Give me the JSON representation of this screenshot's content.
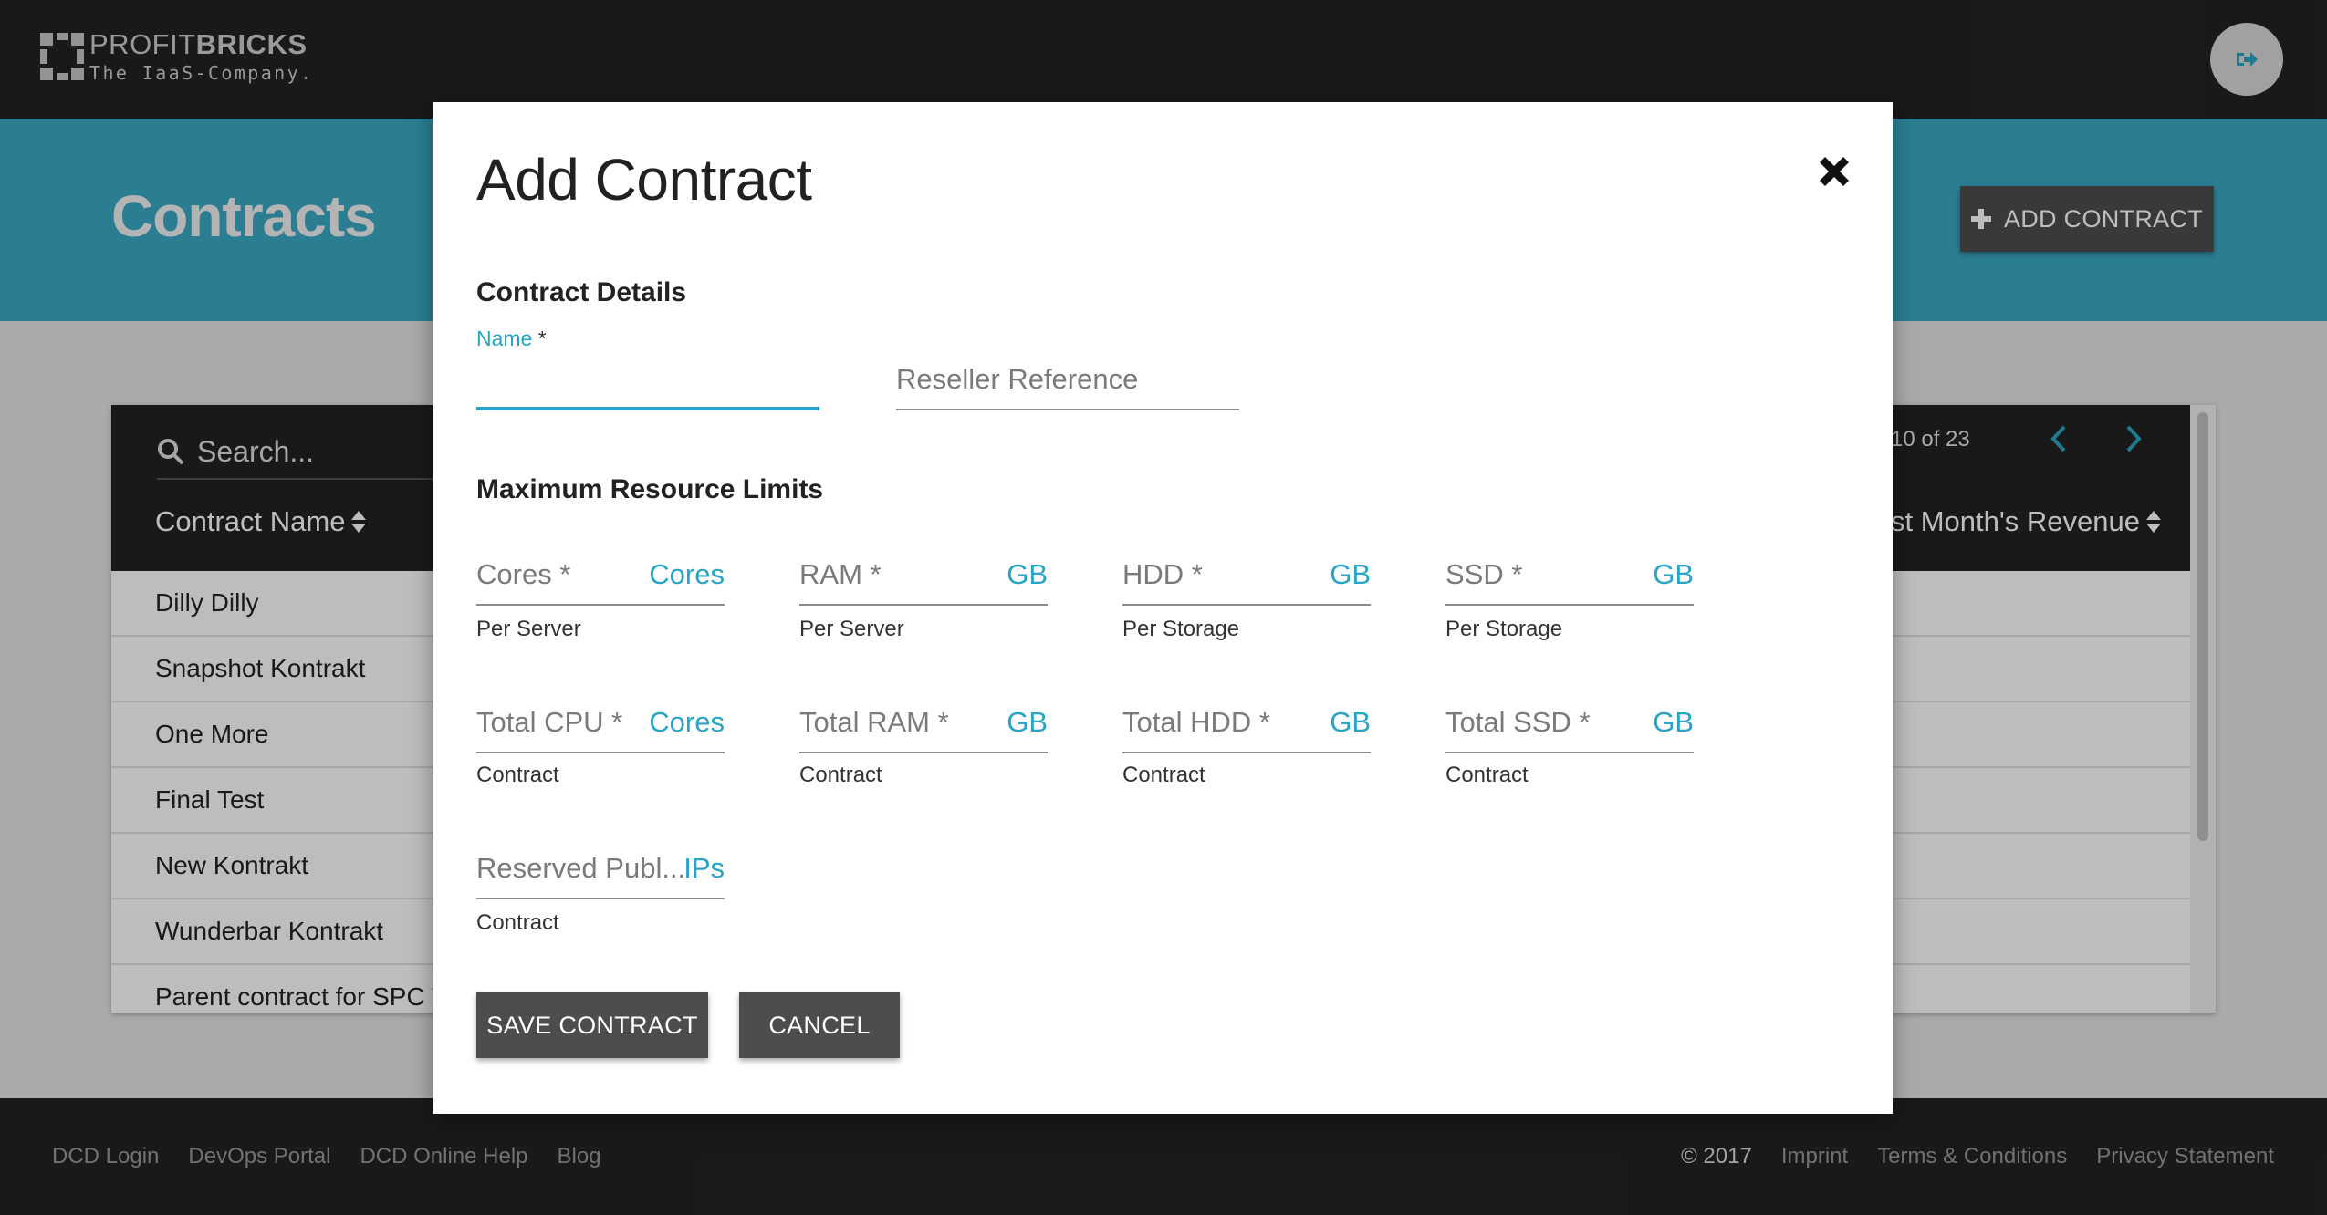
{
  "brand": {
    "name_light": "PROFIT",
    "name_bold": "BRICKS",
    "tagline": "The IaaS-Company."
  },
  "header": {
    "title": "Contracts",
    "add_contract_label": "ADD CONTRACT",
    "logout_icon": "logout-icon"
  },
  "table": {
    "search_placeholder": "Search...",
    "col_contract_name": "Contract Name",
    "col_revenue_partial": "st Month's Revenue",
    "pager_partial": "10 of 23",
    "rows": [
      "Dilly Dilly",
      "Snapshot Kontrakt",
      "One More",
      "Final Test",
      "New Kontrakt",
      "Wunderbar Kontrakt",
      "Parent contract for SPC T"
    ]
  },
  "modal": {
    "title": "Add Contract",
    "close_icon": "close-icon",
    "section_details": "Contract Details",
    "name_label": "Name",
    "name_required": " *",
    "name_value": "",
    "reseller_label": "Reseller Reference",
    "section_limits": "Maximum Resource Limits",
    "per_fields": [
      {
        "label": "Cores *",
        "unit": "Cores",
        "helper": "Per Server"
      },
      {
        "label": "RAM *",
        "unit": "GB",
        "helper": "Per Server"
      },
      {
        "label": "HDD *",
        "unit": "GB",
        "helper": "Per Storage"
      },
      {
        "label": "SSD *",
        "unit": "GB",
        "helper": "Per Storage"
      }
    ],
    "total_fields": [
      {
        "label": "Total CPU *",
        "unit": "Cores",
        "helper": "Contract"
      },
      {
        "label": "Total RAM *",
        "unit": "GB",
        "helper": "Contract"
      },
      {
        "label": "Total HDD *",
        "unit": "GB",
        "helper": "Contract"
      },
      {
        "label": "Total SSD *",
        "unit": "GB",
        "helper": "Contract"
      }
    ],
    "reserved_field": {
      "label": "Reserved Publ...",
      "unit": "IPs",
      "helper": "Contract"
    },
    "save_label": "SAVE CONTRACT",
    "cancel_label": "CANCEL"
  },
  "footer": {
    "links_left": [
      "DCD Login",
      "DevOps Portal",
      "DCD Online Help",
      "Blog"
    ],
    "copyright": "© 2017",
    "links_right": [
      "Imprint",
      "Terms & Conditions",
      "Privacy Statement"
    ]
  },
  "colors": {
    "accent": "#2aa4c4",
    "hero": "#3aaac6",
    "dark": "#232323",
    "button": "#4d4d4d"
  }
}
